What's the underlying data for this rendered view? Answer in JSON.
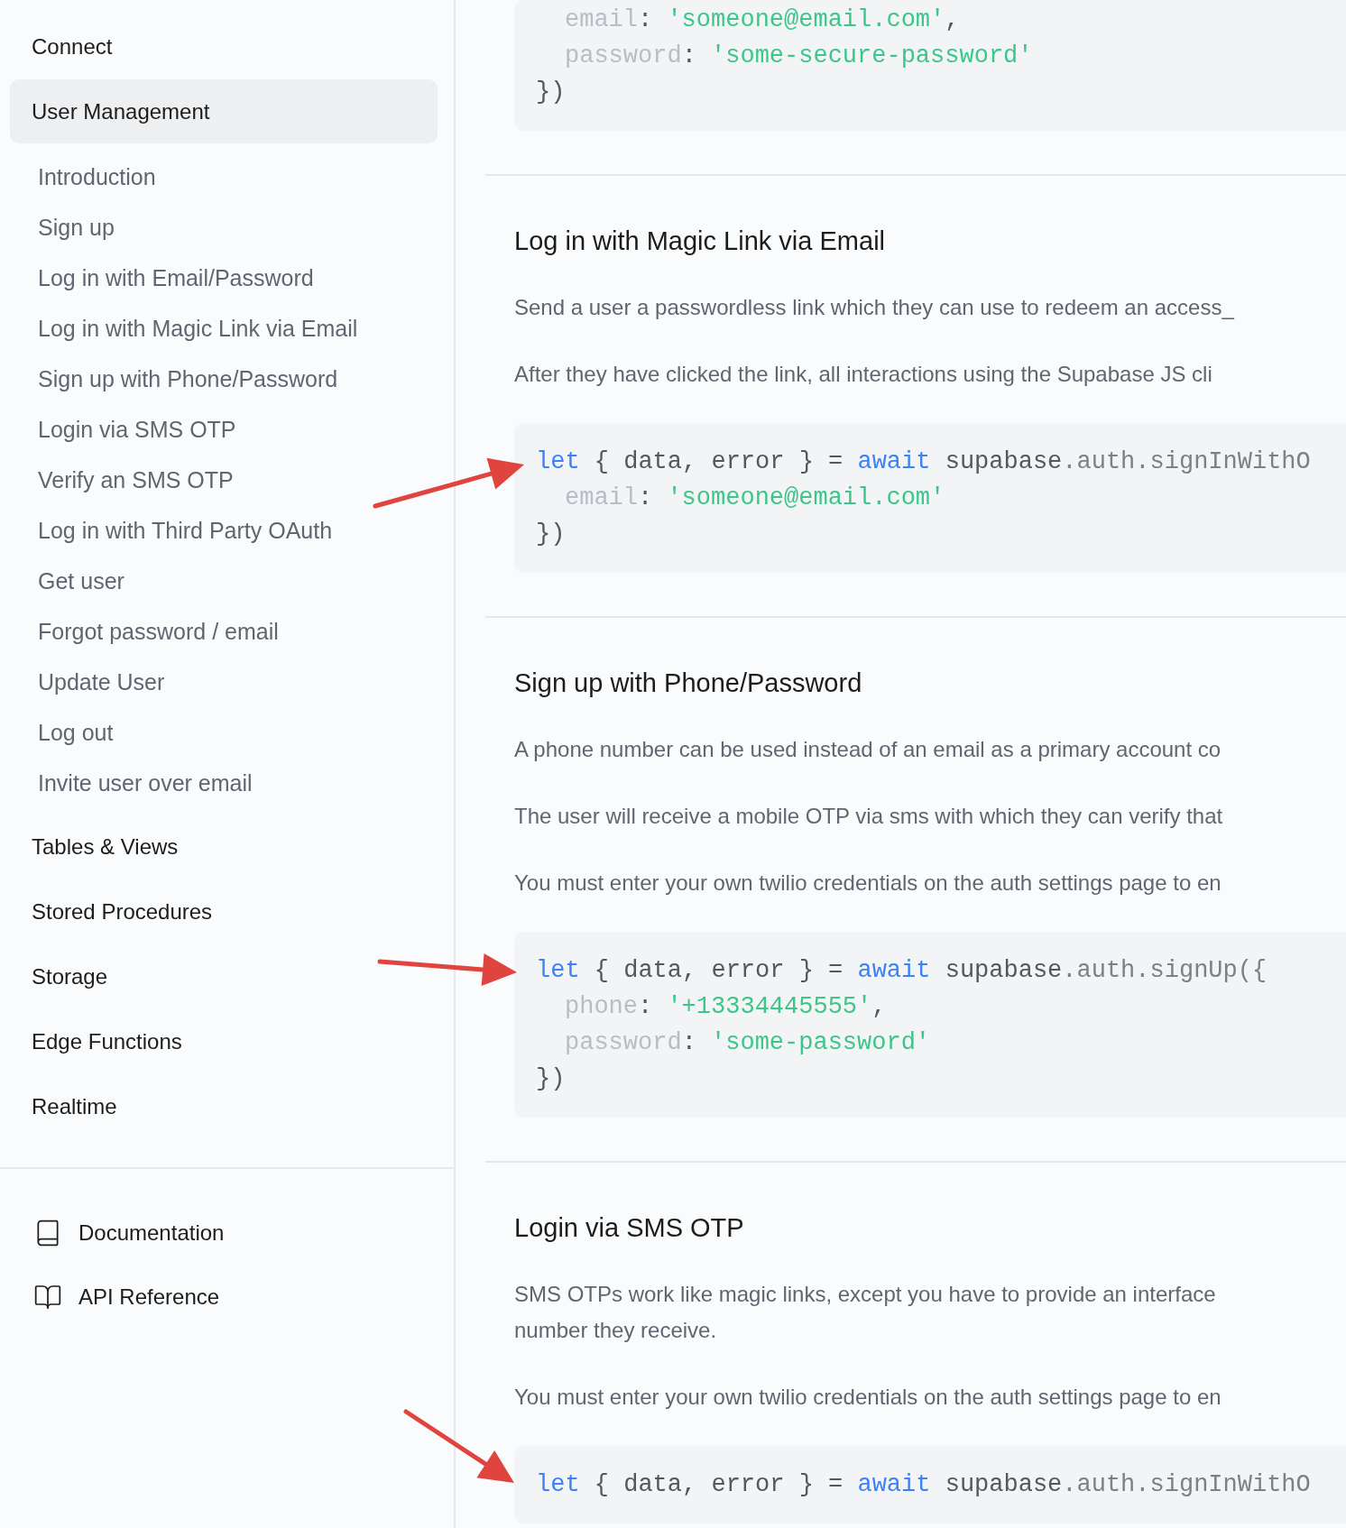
{
  "sidebar": {
    "items": [
      {
        "label": "Connect",
        "selected": false
      },
      {
        "label": "User Management",
        "selected": true,
        "children": [
          {
            "label": "Introduction"
          },
          {
            "label": "Sign up"
          },
          {
            "label": "Log in with Email/Password"
          },
          {
            "label": "Log in with Magic Link via Email"
          },
          {
            "label": "Sign up with Phone/Password"
          },
          {
            "label": "Login via SMS OTP"
          },
          {
            "label": "Verify an SMS OTP"
          },
          {
            "label": "Log in with Third Party OAuth"
          },
          {
            "label": "Get user"
          },
          {
            "label": "Forgot password / email"
          },
          {
            "label": "Update User"
          },
          {
            "label": "Log out"
          },
          {
            "label": "Invite user over email"
          }
        ]
      },
      {
        "label": "Tables & Views",
        "selected": false
      },
      {
        "label": "Stored Procedures",
        "selected": false
      },
      {
        "label": "Storage",
        "selected": false
      },
      {
        "label": "Edge Functions",
        "selected": false
      },
      {
        "label": "Realtime",
        "selected": false
      }
    ],
    "footer_links": [
      {
        "label": "Documentation",
        "kind": "book"
      },
      {
        "label": "API Reference",
        "kind": "openbook"
      }
    ]
  },
  "content": {
    "sections": [
      {
        "code": {
          "lines": [
            {
              "indent": true,
              "tokens": [
                {
                  "kind": "prop",
                  "text": "email"
                },
                {
                  "kind": "plain",
                  "text": ": "
                },
                {
                  "kind": "string",
                  "text": "'someone@email.com'"
                },
                {
                  "kind": "plain",
                  "text": ","
                }
              ]
            },
            {
              "indent": true,
              "tokens": [
                {
                  "kind": "prop",
                  "text": "password"
                },
                {
                  "kind": "plain",
                  "text": ": "
                },
                {
                  "kind": "string",
                  "text": "'some-secure-password'"
                }
              ]
            },
            {
              "indent": false,
              "tokens": [
                {
                  "kind": "plain",
                  "text": "})"
                }
              ]
            }
          ]
        }
      },
      {
        "heading": "Log in with Magic Link via Email",
        "paragraphs": [
          "Send a user a passwordless link which they can use to redeem an access_",
          "After they have clicked the link, all interactions using the Supabase JS cli"
        ],
        "code": {
          "kind": "rising",
          "lines": [
            {
              "indent": false,
              "tokens": [
                {
                  "kind": "keyword",
                  "text": "let"
                },
                {
                  "kind": "plain",
                  "text": " { data, error } = "
                },
                {
                  "kind": "keyword",
                  "text": "await"
                },
                {
                  "kind": "plain",
                  "text": " supabase"
                },
                {
                  "kind": "member",
                  "text": ".auth.signInWithO"
                }
              ]
            },
            {
              "indent": true,
              "tokens": [
                {
                  "kind": "prop",
                  "text": "email"
                },
                {
                  "kind": "plain",
                  "text": ": "
                },
                {
                  "kind": "string",
                  "text": "'someone@email.com'"
                }
              ]
            },
            {
              "indent": false,
              "tokens": [
                {
                  "kind": "plain",
                  "text": "})"
                }
              ]
            }
          ]
        }
      },
      {
        "heading": "Sign up with Phone/Password",
        "paragraphs": [
          "A phone number can be used instead of an email as a primary account co",
          "The user will receive a mobile OTP via sms with which they can verify that",
          "You must enter your own twilio credentials on the auth settings page to en"
        ],
        "code": {
          "kind": "level",
          "lines": [
            {
              "indent": false,
              "tokens": [
                {
                  "kind": "keyword",
                  "text": "let"
                },
                {
                  "kind": "plain",
                  "text": " { data, error } = "
                },
                {
                  "kind": "keyword",
                  "text": "await"
                },
                {
                  "kind": "plain",
                  "text": " supabase"
                },
                {
                  "kind": "member",
                  "text": ".auth.signUp({"
                }
              ]
            },
            {
              "indent": true,
              "tokens": [
                {
                  "kind": "prop",
                  "text": "phone"
                },
                {
                  "kind": "plain",
                  "text": ": "
                },
                {
                  "kind": "string",
                  "text": "'+13334445555'"
                },
                {
                  "kind": "plain",
                  "text": ","
                }
              ]
            },
            {
              "indent": true,
              "tokens": [
                {
                  "kind": "prop",
                  "text": "password"
                },
                {
                  "kind": "plain",
                  "text": ": "
                },
                {
                  "kind": "string",
                  "text": "'some-password'"
                }
              ]
            },
            {
              "indent": false,
              "tokens": [
                {
                  "kind": "plain",
                  "text": "})"
                }
              ]
            }
          ]
        }
      },
      {
        "heading": "Login via SMS OTP",
        "paragraphs": [
          "SMS OTPs work like magic links, except you have to provide an interface\nnumber they receive.",
          "You must enter your own twilio credentials on the auth settings page to en"
        ],
        "code": {
          "kind": "falling",
          "lines": [
            {
              "indent": false,
              "tokens": [
                {
                  "kind": "keyword",
                  "text": "let"
                },
                {
                  "kind": "plain",
                  "text": " { data, error } = "
                },
                {
                  "kind": "keyword",
                  "text": "await"
                },
                {
                  "kind": "plain",
                  "text": " supabase"
                },
                {
                  "kind": "member",
                  "text": ".auth.signInWithO"
                }
              ]
            }
          ]
        }
      }
    ]
  }
}
